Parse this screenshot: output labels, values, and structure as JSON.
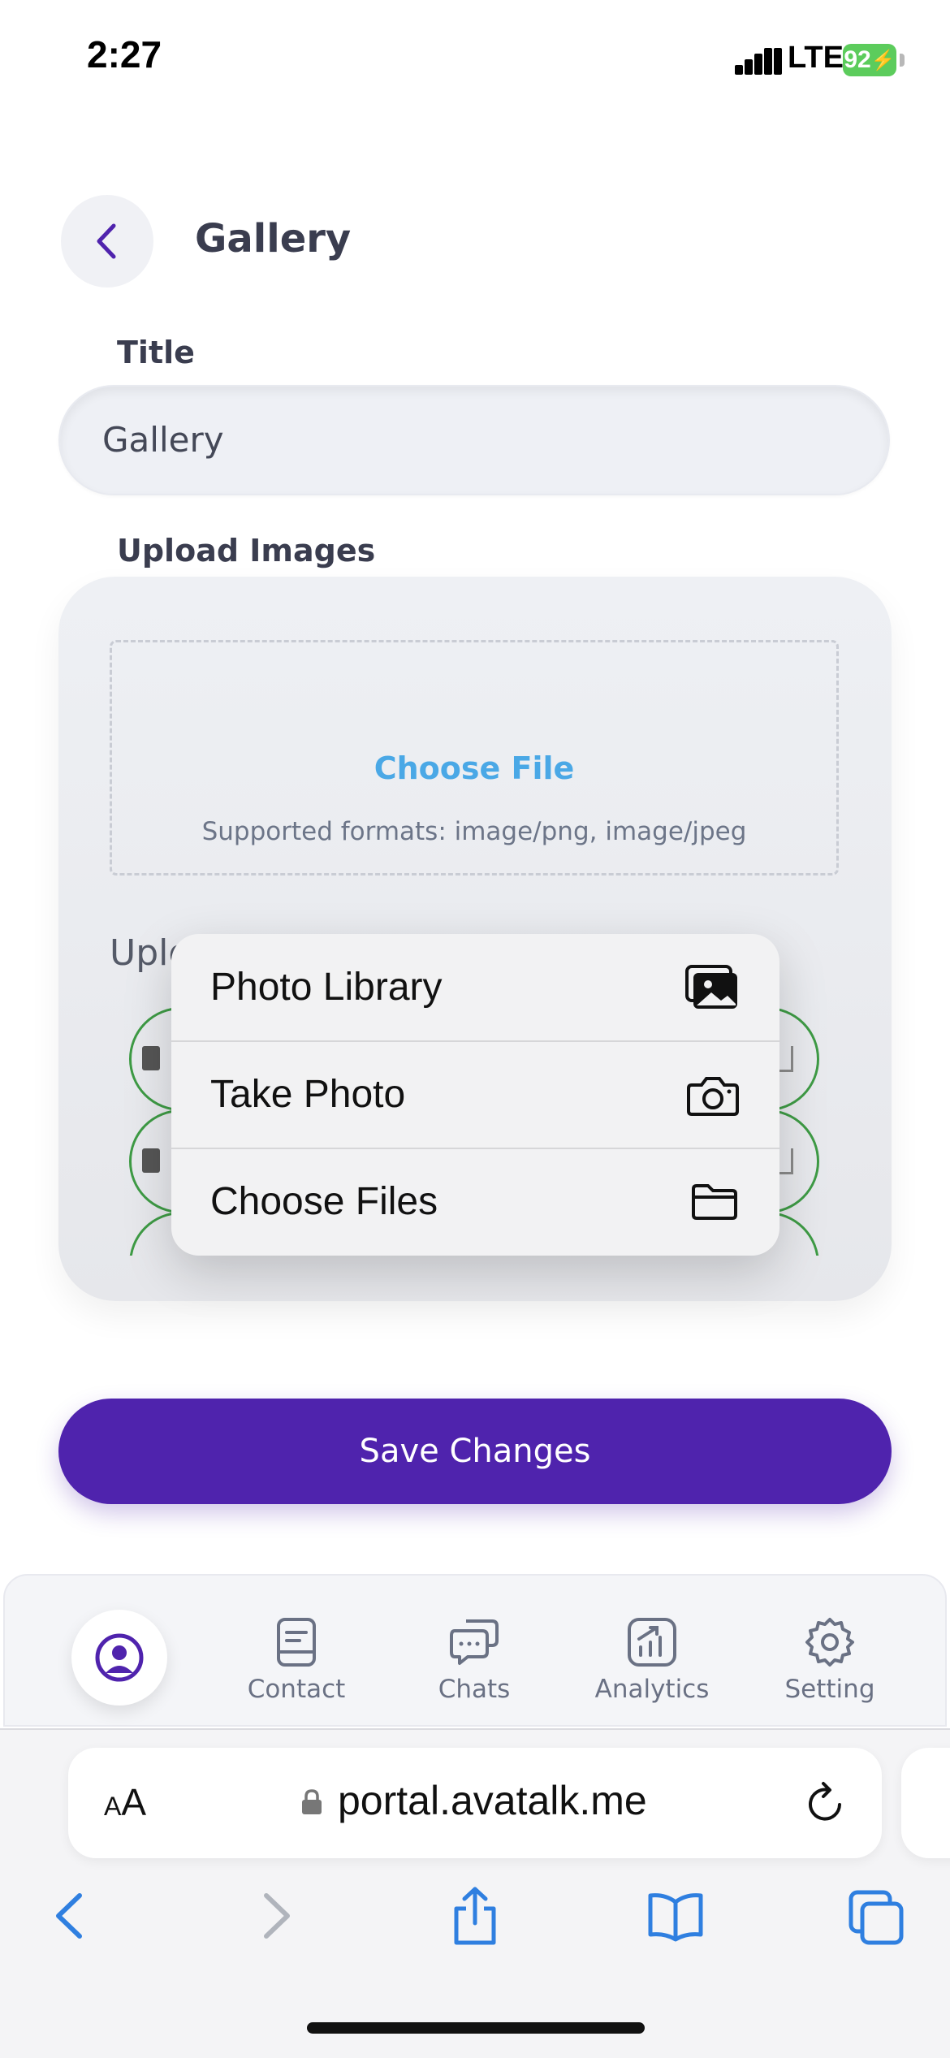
{
  "status": {
    "time": "2:27",
    "network": "LTE",
    "battery": "92"
  },
  "header": {
    "title": "Gallery",
    "back_icon": "chevron-left-icon"
  },
  "form": {
    "title_label": "Title",
    "title_value": "Gallery",
    "upload_label": "Upload Images",
    "choose_file": "Choose File",
    "supported_formats": "Supported formats: image/png, image/jpeg",
    "uploaded_label_partial": "Uplo"
  },
  "menu": {
    "items": [
      {
        "label": "Photo Library",
        "icon": "photo-library-icon"
      },
      {
        "label": "Take Photo",
        "icon": "camera-icon"
      },
      {
        "label": "Choose Files",
        "icon": "folder-icon"
      }
    ]
  },
  "save_button": "Save Changes",
  "bottom_nav": {
    "items": [
      {
        "label": "Contact",
        "icon": "contact-book-icon"
      },
      {
        "label": "Chats",
        "icon": "chat-bubbles-icon"
      },
      {
        "label": "Analytics",
        "icon": "analytics-icon"
      },
      {
        "label": "Setting",
        "icon": "gear-icon"
      }
    ],
    "active_icon": "profile-icon"
  },
  "browser": {
    "text_size_label": "AA",
    "url": "portal.avatalk.me"
  },
  "colors": {
    "primary": "#4f23ad",
    "link": "#4aa8e6",
    "pill_border": "#3e9b45",
    "ios_blue": "#2f7fe0"
  }
}
